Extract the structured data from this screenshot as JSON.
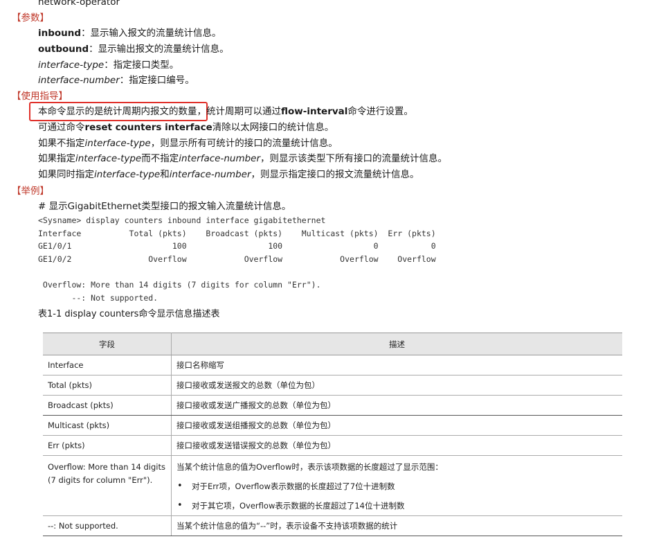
{
  "top_partial": "network-operator",
  "params": {
    "heading": "【参数】",
    "items": [
      {
        "kw": "inbound",
        "desc": "：显示输入报文的流量统计信息。"
      },
      {
        "kw": "outbound",
        "desc": "：显示输出报文的流量统计信息。"
      },
      {
        "kw": "interface-type",
        "desc": "：指定接口类型。"
      },
      {
        "kw": "interface-number",
        "desc": "：指定接口编号。"
      }
    ]
  },
  "usage": {
    "heading": "【使用指导】",
    "l1_a": "本命令显示的是统计周期内报文的数量",
    "l1_b": "，统计周期可以通过",
    "l1_cmd": "flow-interval",
    "l1_c": "命令进行设置。",
    "l2_a": "可通过命令",
    "l2_cmd": "reset counters interface",
    "l2_b": "清除以太网接口的统计信息。",
    "l3_a": "如果不指定",
    "l3_it": "interface-type",
    "l3_b": "，则显示所有可统计的接口的流量统计信息。",
    "l4_a": "如果指定",
    "l4_it1": "interface-type",
    "l4_b": "而不指定",
    "l4_it2": "interface-number",
    "l4_c": "，则显示该类型下所有接口的流量统计信息。",
    "l5_a": "如果同时指定",
    "l5_it1": "interface-type",
    "l5_b": "和",
    "l5_it2": "interface-number",
    "l5_c": "，则显示指定接口的报文流量统计信息。"
  },
  "example": {
    "heading": "【举例】",
    "comment": "# 显示GigabitEthernet类型接口的报文输入流量统计信息。",
    "code": "<Sysname> display counters inbound interface gigabitethernet\nInterface          Total (pkts)    Broadcast (pkts)    Multicast (pkts)  Err (pkts)\nGE1/0/1                     100                 100                   0           0\nGE1/0/2                Overflow            Overflow            Overflow    Overflow\n\n Overflow: More than 14 digits (7 digits for column \"Err\").\n       --: Not supported."
  },
  "table": {
    "caption": "表1-1 display counters命令显示信息描述表",
    "headers": [
      "字段",
      "描述"
    ],
    "rows": [
      {
        "field": "Interface",
        "desc": "接口名称缩写"
      },
      {
        "field": "Total (pkts)",
        "desc": "接口接收或发送报文的总数（单位为包）"
      },
      {
        "field": "Broadcast (pkts)",
        "desc": "接口接收或发送广播报文的总数（单位为包）"
      },
      {
        "field": "Multicast (pkts)",
        "desc": "接口接收或发送组播报文的总数（单位为包）"
      },
      {
        "field": "Err (pkts)",
        "desc": "接口接收或发送错误报文的总数（单位为包）"
      },
      {
        "field": "Overflow: More than 14 digits (7 digits for column \"Err\").",
        "desc": "当某个统计信息的值为Overflow时，表示该项数据的长度超过了显示范围：",
        "bullets": [
          "对于Err项，Overflow表示数据的长度超过了7位十进制数",
          "对于其它项，Overflow表示数据的长度超过了14位十进制数"
        ]
      },
      {
        "field": "--: Not supported.",
        "desc": "当某个统计信息的值为“--”时，表示设备不支持该项数据的统计"
      }
    ]
  }
}
